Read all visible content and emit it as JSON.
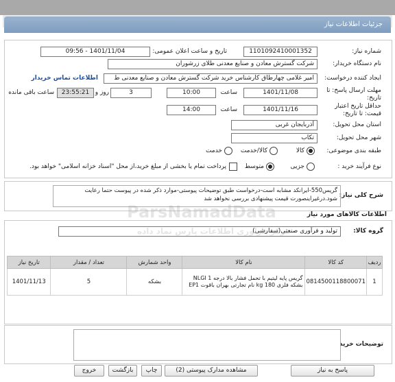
{
  "header": {
    "title": "جزئیات اطلاعات نیاز"
  },
  "fields": {
    "need_number_label": "شماره نیاز:",
    "need_number": "1101092410001352",
    "announce_label": "تاریخ و ساعت اعلان عمومی:",
    "announce_value": "1401/11/04 - 09:56",
    "buyer_org_label": "نام دستگاه خریدار:",
    "buyer_org": "شرکت گسترش معادن و صنایع معدنی طلای زرشوران",
    "creator_label": "ایجاد کننده درخواست:",
    "creator": "امیر  غلامی چهارطاق کارشناس خرید شرکت گسترش معادن و صنایع معدنی ط",
    "contact_link": "اطلاعات تماس خریدار",
    "send_deadline_label": "مهلت ارسال پاسخ: تا تاریخ:",
    "send_deadline_date": "1401/11/08",
    "send_deadline_time_label": "ساعت",
    "send_deadline_time": "10:00",
    "days_value": "3",
    "days_label": "روز و",
    "remaining_time": "23:55:21",
    "remaining_label": "ساعت باقی مانده",
    "min_validity_label": "حداقل تاریخ اعتبار قیمت: تا تاریخ:",
    "validity_date": "1401/11/16",
    "validity_time_label": "ساعت",
    "validity_time": "14:00",
    "province_label": "استان محل تحویل:",
    "province": "آذربایجان غربی",
    "city_label": "شهر محل تحویل:",
    "city": "تکاب",
    "category_label": "طبقه بندی موضوعی:",
    "category_options": [
      "کالا",
      "کالا/خدمت",
      "خدمت"
    ],
    "process_label": "نوع فرآیند خرید :",
    "process_options": [
      "جزیی",
      "متوسط"
    ],
    "payment_note": "پرداخت تمام یا بخشی از مبلغ خرید،از محل \"اسناد خزانه اسلامی\" خواهد بود."
  },
  "need_desc": {
    "label": "شرح کلی نیاز:",
    "text": "گریس550-ایرانکد مشابه است-درخواست طبق توضیحات پیوستی-موارد ذکر شده در پیوست حتما رعایت شود.درغیراینصورت قیمت پیشنهادی بررسی نخواهد شد"
  },
  "goods": {
    "section_title": "اطلاعات کالاهای مورد نیاز",
    "group_label": "گروه کالا:",
    "group_value": "تولید و فرآوری صنعتی(سفارشی)",
    "columns": [
      "ردیف",
      "کد کالا",
      "نام کالا",
      "واحد شمارش",
      "تعداد / مقدار",
      "تاریخ نیاز"
    ],
    "rows": [
      [
        "1",
        "0814500118800071",
        "گریس پایه لیتیم با تحمل فشار بالا درجه NLGI 1 بشکه فلزی 180 kg نام تجارتی بهران باقوت EP1",
        "بشکه",
        "5",
        "1401/11/13"
      ]
    ]
  },
  "buyer_notes": {
    "label": "توضیحات خریدار:",
    "value": ""
  },
  "buttons": {
    "reply": "پاسخ به نیاز",
    "view_attachments": "مشاهده مدارک پیوستی (2)",
    "print": "چاپ",
    "back": "بازگشت",
    "exit": "خروج"
  },
  "watermark": {
    "text1": "ParsNamadData",
    "text2": "مرکز فراوری اطلاعات پارس نماد داده"
  },
  "colors": {
    "header": "#8aa6c8",
    "link": "#1a4fa0"
  }
}
